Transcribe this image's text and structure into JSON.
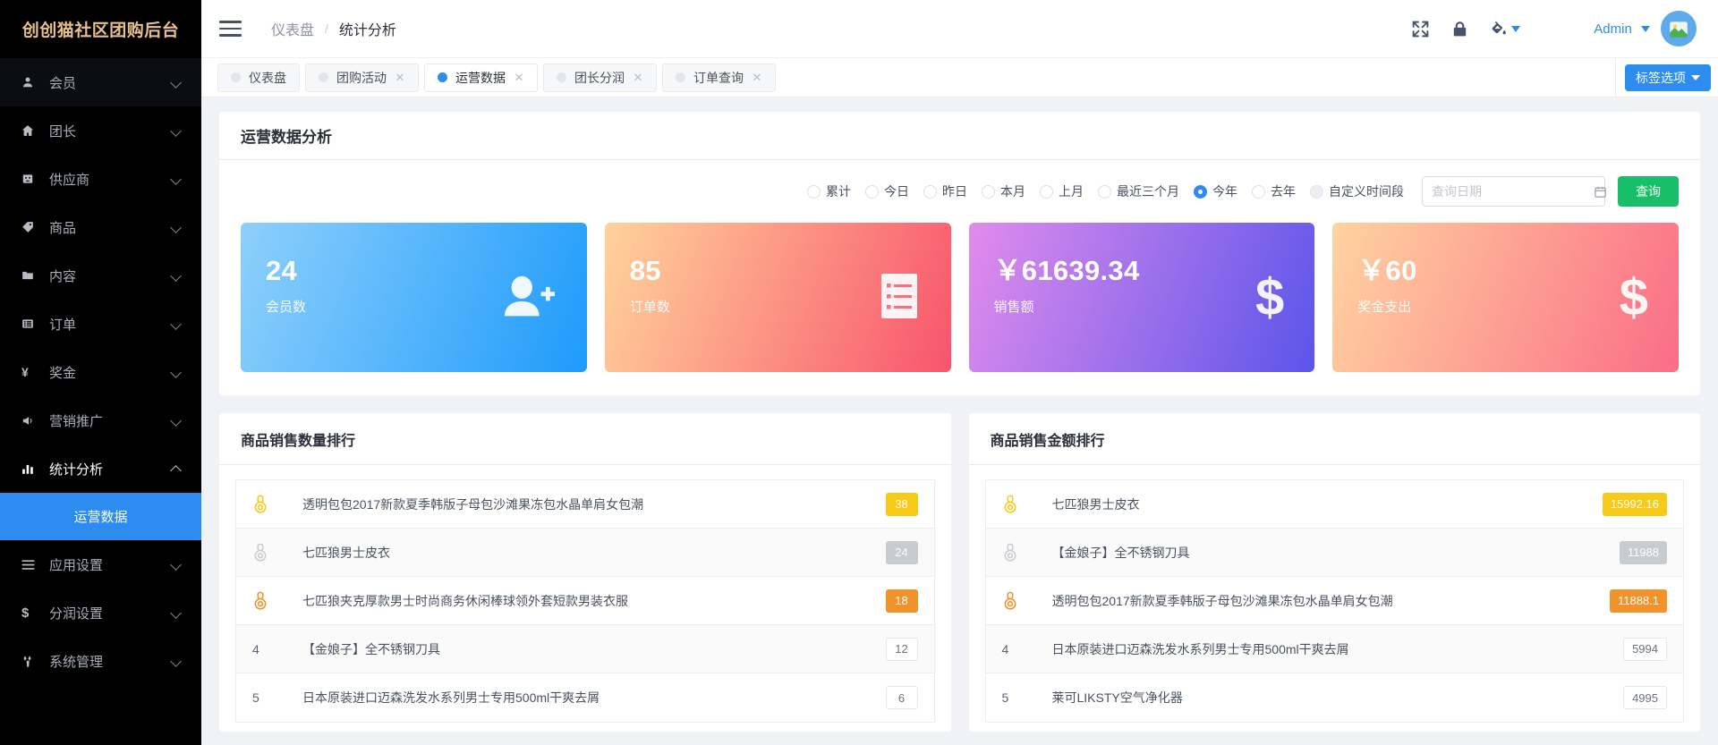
{
  "brand": {
    "title": "创创猫社区团购后台"
  },
  "sidebar": {
    "items": [
      {
        "label": "会员",
        "icon": "user-icon",
        "expanded": false
      },
      {
        "label": "团长",
        "icon": "home-icon",
        "expanded": false
      },
      {
        "label": "供应商",
        "icon": "factory-icon",
        "expanded": false
      },
      {
        "label": "商品",
        "icon": "tag-icon",
        "expanded": false
      },
      {
        "label": "内容",
        "icon": "folder-icon",
        "expanded": false
      },
      {
        "label": "订单",
        "icon": "list-icon",
        "expanded": false
      },
      {
        "label": "奖金",
        "icon": "yen-icon",
        "expanded": false
      },
      {
        "label": "营销推广",
        "icon": "megaphone-icon",
        "expanded": false
      },
      {
        "label": "统计分析",
        "icon": "bar-chart-icon",
        "expanded": true
      },
      {
        "label": "应用设置",
        "icon": "menu-lines-icon",
        "expanded": false
      },
      {
        "label": "分润设置",
        "icon": "dollar-icon",
        "expanded": false
      },
      {
        "label": "系统管理",
        "icon": "wrench-icon",
        "expanded": false
      }
    ],
    "submenu_active": "运营数据"
  },
  "topbar": {
    "breadcrumb": {
      "root": "仪表盘",
      "sep": "/",
      "current": "统计分析"
    },
    "icons": [
      "fullscreen-icon",
      "lock-icon",
      "theme-paint-icon"
    ],
    "user": {
      "name": "Admin"
    }
  },
  "tabs": {
    "items": [
      {
        "label": "仪表盘",
        "closable": false,
        "active": false
      },
      {
        "label": "团购活动",
        "closable": true,
        "active": false
      },
      {
        "label": "运营数据",
        "closable": true,
        "active": true
      },
      {
        "label": "团长分润",
        "closable": true,
        "active": false
      },
      {
        "label": "订单查询",
        "closable": true,
        "active": false
      }
    ],
    "options_button": "标签选项"
  },
  "panel": {
    "title": "运营数据分析"
  },
  "filters": {
    "options": [
      {
        "label": "累计",
        "checked": false,
        "style": "normal"
      },
      {
        "label": "今日",
        "checked": false,
        "style": "normal"
      },
      {
        "label": "昨日",
        "checked": false,
        "style": "normal"
      },
      {
        "label": "本月",
        "checked": false,
        "style": "normal"
      },
      {
        "label": "上月",
        "checked": false,
        "style": "normal"
      },
      {
        "label": "最近三个月",
        "checked": false,
        "style": "normal"
      },
      {
        "label": "今年",
        "checked": true,
        "style": "normal"
      },
      {
        "label": "去年",
        "checked": false,
        "style": "normal"
      },
      {
        "label": "自定义时间段",
        "checked": false,
        "style": "grey"
      }
    ],
    "date_input": {
      "value": "",
      "placeholder": "查询日期"
    },
    "query_button": "查询"
  },
  "stat_cards": [
    {
      "value": "24",
      "label": "会员数",
      "icon": "user-add-icon",
      "from": "#8ed0fb",
      "to": "#1e9bfb"
    },
    {
      "value": "85",
      "label": "订单数",
      "icon": "order-list-icon",
      "from": "#ffd39b",
      "to": "#f8546c"
    },
    {
      "value": "￥61639.34",
      "label": "销售额",
      "icon": "dollar-sign-icon",
      "from": "#e08cec",
      "to": "#5b55ea"
    },
    {
      "value": "￥60",
      "label": "奖金支出",
      "icon": "dollar-sign-icon",
      "from": "#ffd3a0",
      "to": "#fa6d86"
    }
  ],
  "rank_qty": {
    "title": "商品销售数量排行",
    "rows": [
      {
        "rank": "1",
        "medal": "gold",
        "name": "透明包包2017新款夏季韩版子母包沙滩果冻包水晶单肩女包潮",
        "value": "38",
        "style": "gold"
      },
      {
        "rank": "2",
        "medal": "silver",
        "name": "七匹狼男士皮衣",
        "value": "24",
        "style": "silver"
      },
      {
        "rank": "3",
        "medal": "bronze",
        "name": "七匹狼夹克厚款男士时尚商务休闲棒球领外套短款男装衣服",
        "value": "18",
        "style": "bronze"
      },
      {
        "rank": "4",
        "medal": "",
        "name": "【金娘子】全不锈钢刀具",
        "value": "12",
        "style": "plain"
      },
      {
        "rank": "5",
        "medal": "",
        "name": "日本原装进口迈森洗发水系列男士专用500ml干爽去屑",
        "value": "6",
        "style": "plain"
      }
    ]
  },
  "rank_amount": {
    "title": "商品销售金额排行",
    "rows": [
      {
        "rank": "1",
        "medal": "gold",
        "name": "七匹狼男士皮衣",
        "value": "15992.16",
        "style": "gold"
      },
      {
        "rank": "2",
        "medal": "silver",
        "name": "【金娘子】全不锈钢刀具",
        "value": "11988",
        "style": "silver"
      },
      {
        "rank": "3",
        "medal": "bronze",
        "name": "透明包包2017新款夏季韩版子母包沙滩果冻包水晶单肩女包潮",
        "value": "11888.1",
        "style": "bronze"
      },
      {
        "rank": "4",
        "medal": "",
        "name": "日本原装进口迈森洗发水系列男士专用500ml干爽去屑",
        "value": "5994",
        "style": "plain"
      },
      {
        "rank": "5",
        "medal": "",
        "name": "莱可LIKSTY空气净化器",
        "value": "4995",
        "style": "plain"
      }
    ]
  },
  "colors": {
    "accent_blue": "#2d8cf0",
    "brand_gold": "#e9c08a",
    "green": "#19be6b",
    "gold_badge": "#f7ca18",
    "silver_badge": "#c7ccd1",
    "bronze_badge": "#f0932b"
  }
}
